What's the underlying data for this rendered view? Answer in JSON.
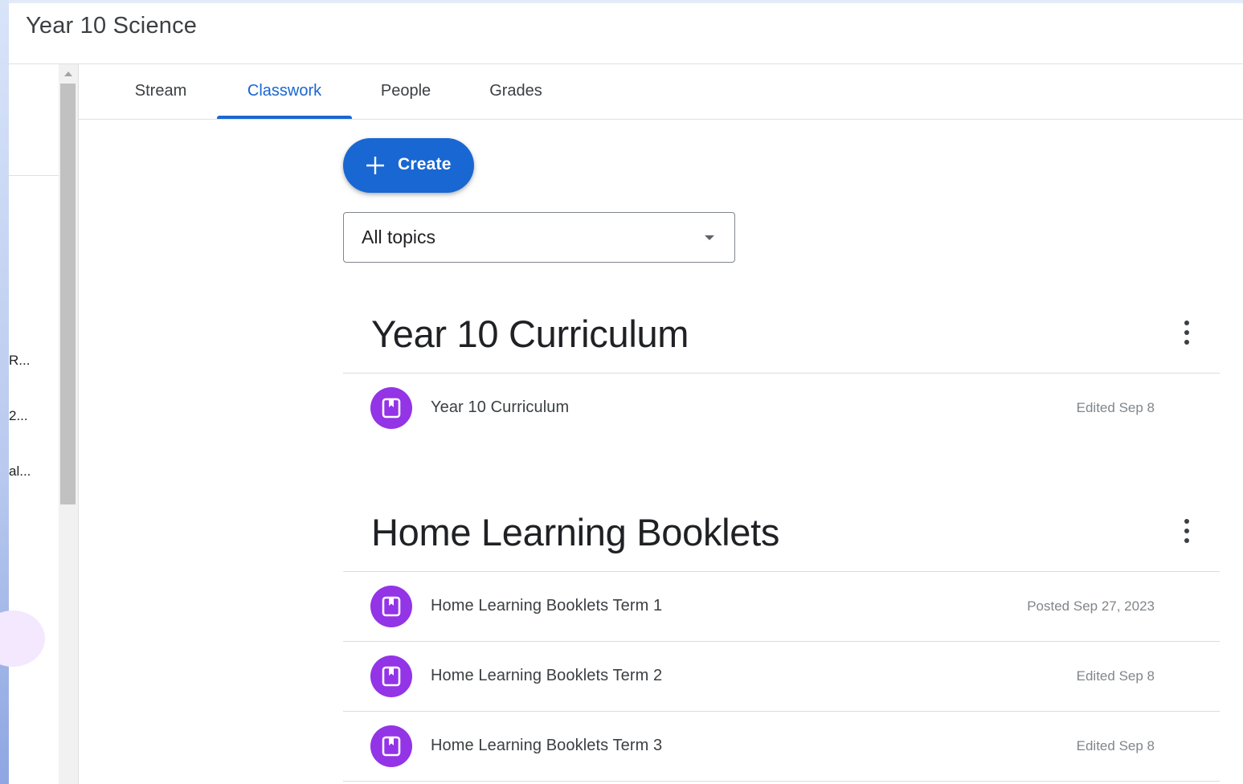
{
  "app": {
    "title": "Year 10 Science"
  },
  "sidebar": {
    "items": [
      {
        "label": "R..."
      },
      {
        "label": "2..."
      },
      {
        "label": "al..."
      }
    ]
  },
  "tabs": [
    {
      "label": "Stream",
      "active": false
    },
    {
      "label": "Classwork",
      "active": true
    },
    {
      "label": "People",
      "active": false
    },
    {
      "label": "Grades",
      "active": false
    }
  ],
  "toolbar": {
    "create_label": "Create",
    "create_icon": "plus-icon"
  },
  "filter": {
    "selected": "All topics"
  },
  "sections": [
    {
      "title": "Year 10 Curriculum",
      "items": [
        {
          "title": "Year 10 Curriculum",
          "date": "Edited Sep 8",
          "icon": "material-book-icon"
        }
      ]
    },
    {
      "title": "Home Learning Booklets",
      "items": [
        {
          "title": "Home Learning Booklets Term 1",
          "date": "Posted Sep 27, 2023",
          "icon": "material-book-icon"
        },
        {
          "title": "Home Learning Booklets Term 2",
          "date": "Edited Sep 8",
          "icon": "material-book-icon"
        },
        {
          "title": "Home Learning Booklets Term 3",
          "date": "Edited Sep 8",
          "icon": "material-book-icon"
        }
      ]
    }
  ],
  "colors": {
    "accent": "#1967d2",
    "material_icon_bg": "#9334e6",
    "text_primary": "#202124",
    "text_secondary": "#80868b"
  }
}
